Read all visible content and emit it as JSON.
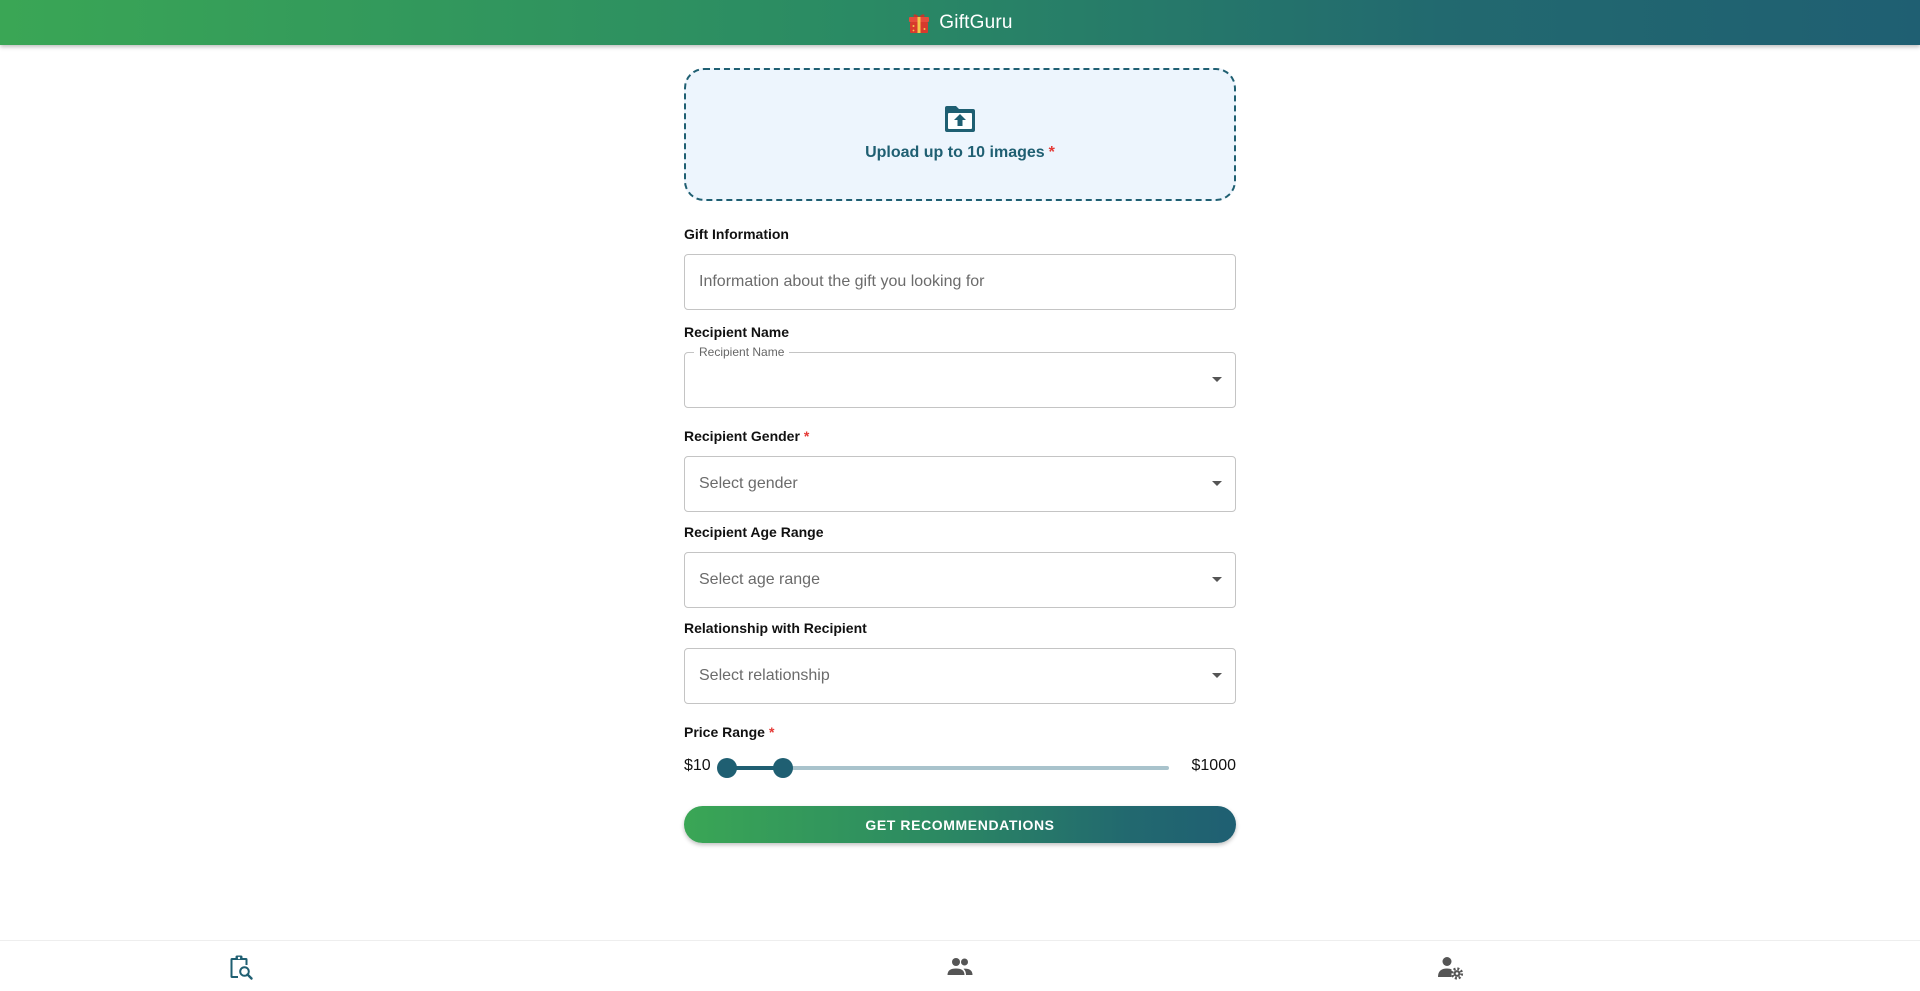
{
  "app": {
    "title": "GiftGuru",
    "logo_icon": "gift-box-icon"
  },
  "colors": {
    "accent": "#1f5f72",
    "gradient_start": "#3aa655",
    "gradient_end": "#1f5f72",
    "required": "#e53935",
    "upload_bg": "#edf5fd"
  },
  "upload": {
    "text": "Upload up to 10 images",
    "required_mark": "*",
    "icon": "folder-upload-icon"
  },
  "gift_info": {
    "label": "Gift Information",
    "placeholder": "Information about the gift you looking for",
    "value": ""
  },
  "recipient_name": {
    "label": "Recipient Name",
    "floating_label": "Recipient Name",
    "value": ""
  },
  "recipient_gender": {
    "label": "Recipient Gender",
    "required_mark": "*",
    "placeholder": "Select gender"
  },
  "recipient_age": {
    "label": "Recipient Age Range",
    "placeholder": "Select age range"
  },
  "relationship": {
    "label": "Relationship with Recipient",
    "placeholder": "Select relationship"
  },
  "price": {
    "label": "Price Range",
    "required_mark": "*",
    "min_label": "$10",
    "max_label": "$1000",
    "range_min": 10,
    "range_max": 1000,
    "selected_low": 10,
    "selected_high": 135
  },
  "cta": {
    "label": "GET RECOMMENDATIONS"
  },
  "bottom_nav": {
    "items": [
      {
        "icon": "clipboard-search-icon",
        "active": true
      },
      {
        "icon": "people-icon",
        "active": false
      },
      {
        "icon": "user-settings-icon",
        "active": false
      }
    ]
  }
}
